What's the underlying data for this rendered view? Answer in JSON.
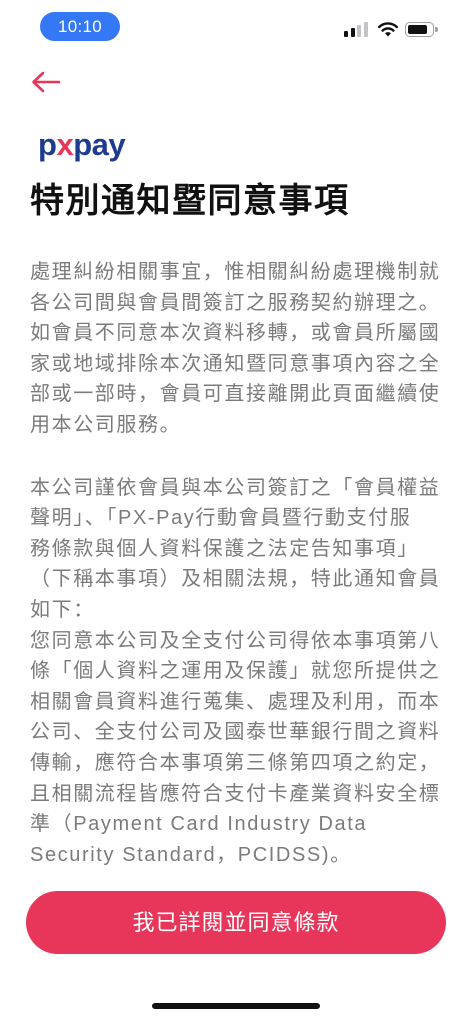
{
  "status_bar": {
    "time": "10:10",
    "time_pill_color": "#3478f6",
    "signal_level": 2,
    "signal_max": 4,
    "battery_level": 0.85,
    "icons": [
      "signal-icon",
      "wifi-icon",
      "battery-icon"
    ]
  },
  "header": {
    "back_icon": "arrow-left-icon",
    "accent_color": "#e8365a"
  },
  "logo": {
    "part1": "p",
    "part2": "x",
    "part3": "pay",
    "color_primary": "#1f3b8f",
    "color_accent": "#e8365a"
  },
  "page_title": "特別通知暨同意事項",
  "notice": {
    "paragraphs": [
      {
        "lines": [
          "處理糾紛相關事宜，惟相關糾紛處理機制就",
          "各公司間與會員間簽訂之服務契約辦理之。",
          "如會員不同意本次資料移轉，或會員所屬國",
          "家或地域排除本次通知暨同意事項內容之全",
          "部或一部時，會員可直接離開此頁面繼續使",
          "用本公司服務。"
        ]
      },
      {
        "lines": [
          "本公司謹依會員與本公司簽訂之「會員權益",
          "聲明」、「PX-Pay行動會員暨行動支付服",
          "務條款與個人資料保護之法定告知事項」",
          "（下稱本事項）及相關法規，特此通知會員",
          "如下：",
          "您同意本公司及全支付公司得依本事項第八",
          "條「個人資料之運用及保護」就您所提供之",
          "相關會員資料進行蒐集、處理及利用，而本",
          "公司、全支付公司及國泰世華銀行間之資料",
          "傳輸，應符合本事項第三條第四項之約定，",
          "且相關流程皆應符合支付卡產業資料安全標",
          "準（Payment Card Industry Data",
          "Security Standard，PCIDSS)。"
        ]
      }
    ]
  },
  "agree_button": {
    "label": "我已詳閱並同意條款",
    "color": "#e8365a"
  }
}
